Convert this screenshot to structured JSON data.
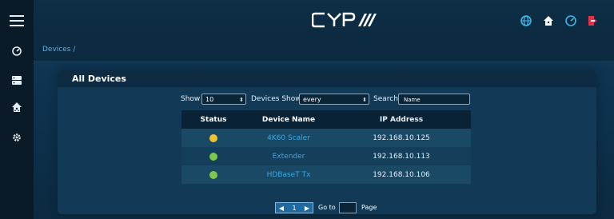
{
  "brand": {
    "logo_text": "CYP"
  },
  "breadcrumb": {
    "text": "Devices /"
  },
  "panel": {
    "title": "All Devices"
  },
  "toolbar": {
    "show_label": "Show",
    "show_value": "10",
    "devices_show_label": "Devices Show",
    "devices_show_value": "every",
    "search_label": "Search",
    "search_placeholder": "Name"
  },
  "table": {
    "headers": [
      "Status",
      "Device Name",
      "IP Address"
    ],
    "rows": [
      {
        "status": "warning",
        "status_color": "#f2c12e",
        "name": "4K60 Scaler",
        "ip": "192.168.10.125"
      },
      {
        "status": "online",
        "status_color": "#7ec84b",
        "name": "Extender",
        "ip": "192.168.10.113"
      },
      {
        "status": "online",
        "status_color": "#7ec84b",
        "name": "HDBaseT Tx",
        "ip": "192.168.10.106"
      }
    ]
  },
  "pagination": {
    "current_page": "1",
    "goto_label": "Go to",
    "page_label": "Page",
    "goto_value": ""
  },
  "icons": {
    "sidebar": [
      "hamburger-menu-icon",
      "dashboard-gauge-icon",
      "server-list-icon",
      "network-home-icon",
      "gear-icon"
    ],
    "topbar": [
      "globe-icon",
      "home-icon",
      "gauge-icon",
      "logout-icon"
    ]
  },
  "colors": {
    "accent": "#3aa8e0",
    "logout": "#e0334a",
    "topbar_icon": "#39b8e8"
  }
}
